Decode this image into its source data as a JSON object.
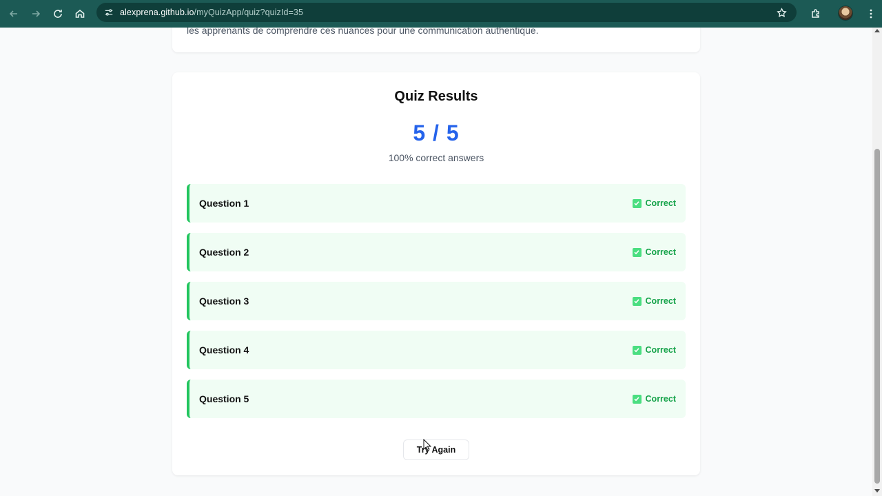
{
  "browser": {
    "url_host": "alexprena.github.io",
    "url_path": "/myQuizApp/quiz?quizId=35",
    "icons": [
      "back-icon",
      "forward-icon",
      "reload-icon",
      "home-icon",
      "site-info-icon",
      "star-icon",
      "extensions-icon",
      "profile-avatar",
      "more-menu-icon"
    ]
  },
  "prev_card": {
    "text": "les apprenants de comprendre ces nuances pour une communication authentique."
  },
  "results": {
    "title": "Quiz Results",
    "score": "5 / 5",
    "percent_text": "100% correct answers",
    "questions": [
      {
        "label": "Question 1",
        "status": "Correct"
      },
      {
        "label": "Question 2",
        "status": "Correct"
      },
      {
        "label": "Question 3",
        "status": "Correct"
      },
      {
        "label": "Question 4",
        "status": "Correct"
      },
      {
        "label": "Question 5",
        "status": "Correct"
      }
    ],
    "try_again_label": "Try Again"
  },
  "colors": {
    "chrome": "#1c5a55",
    "score_blue": "#2563eb",
    "correct_green": "#16a34a",
    "item_bg": "#f0fdf4",
    "item_border": "#22c55e"
  }
}
